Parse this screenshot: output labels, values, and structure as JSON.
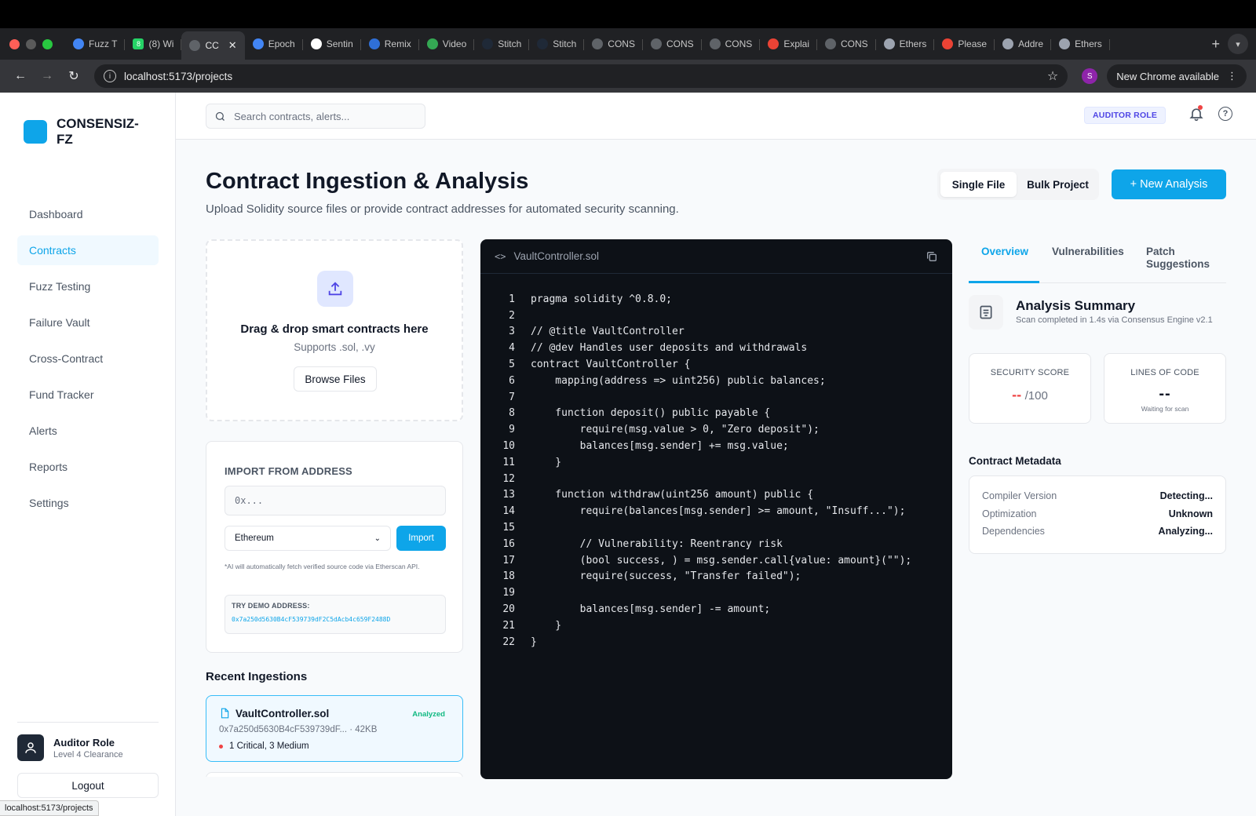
{
  "browser": {
    "tabs": [
      {
        "label": "Fuzz T",
        "icon": "gemini-icon",
        "color": "#4285f4"
      },
      {
        "label": "(8) Wi",
        "icon": "whatsapp-icon",
        "color": "#25d366",
        "badge": "8"
      },
      {
        "label": "CC",
        "icon": "globe-icon",
        "color": "#5f6368",
        "active": true
      },
      {
        "label": "Epoch",
        "icon": "docs-icon",
        "color": "#4285f4"
      },
      {
        "label": "Sentin",
        "icon": "openai-icon",
        "color": "#ffffff"
      },
      {
        "label": "Remix",
        "icon": "remix-icon",
        "color": "#2f6fd6"
      },
      {
        "label": "Video",
        "icon": "video-icon",
        "color": "#34a853"
      },
      {
        "label": "Stitch",
        "icon": "stitch-icon",
        "color": "#1f2937"
      },
      {
        "label": "Stitch",
        "icon": "stitch-icon",
        "color": "#1f2937"
      },
      {
        "label": "CONS",
        "icon": "globe-icon",
        "color": "#5f6368"
      },
      {
        "label": "CONS",
        "icon": "globe-icon",
        "color": "#5f6368"
      },
      {
        "label": "CONS",
        "icon": "globe-icon",
        "color": "#5f6368"
      },
      {
        "label": "Explai",
        "icon": "google-icon",
        "color": "#ea4335"
      },
      {
        "label": "CONS",
        "icon": "globe-icon",
        "color": "#5f6368"
      },
      {
        "label": "Ethers",
        "icon": "etherscan-icon",
        "color": "#9ca3af"
      },
      {
        "label": "Please",
        "icon": "gmail-icon",
        "color": "#ea4335"
      },
      {
        "label": "Addre",
        "icon": "etherscan-icon",
        "color": "#9ca3af"
      },
      {
        "label": "Ethers",
        "icon": "etherscan-icon",
        "color": "#9ca3af"
      }
    ],
    "url": "localhost:5173/projects",
    "profile_initial": "S",
    "new_chrome_label": "New Chrome available",
    "status_url": "localhost:5173/projects"
  },
  "sidebar": {
    "brand": "CONSENSIZ-FZ",
    "items": [
      {
        "label": "Dashboard",
        "active": false
      },
      {
        "label": "Contracts",
        "active": true
      },
      {
        "label": "Fuzz Testing",
        "active": false
      },
      {
        "label": "Failure Vault",
        "active": false
      },
      {
        "label": "Cross-Contract",
        "active": false
      },
      {
        "label": "Fund Tracker",
        "active": false
      },
      {
        "label": "Alerts",
        "active": false
      },
      {
        "label": "Reports",
        "active": false
      },
      {
        "label": "Settings",
        "active": false
      }
    ],
    "user_name": "Auditor Role",
    "user_level": "Level 4 Clearance",
    "logout_label": "Logout"
  },
  "topbar": {
    "search_placeholder": "Search contracts, alerts...",
    "role_badge": "AUDITOR ROLE"
  },
  "page": {
    "title": "Contract Ingestion & Analysis",
    "subtitle": "Upload Solidity source files or provide contract addresses for automated security scanning.",
    "mode_single": "Single File",
    "mode_bulk": "Bulk Project",
    "selected_mode": "Single File",
    "new_analysis": "+ New Analysis"
  },
  "upload": {
    "title": "Drag & drop smart contracts here",
    "subtitle": "Supports .sol, .vy",
    "browse_label": "Browse Files"
  },
  "import": {
    "title": "IMPORT FROM ADDRESS",
    "placeholder": "0x...",
    "network": "Ethereum",
    "button": "Import",
    "note": "*AI will automatically fetch verified source code via Etherscan API.",
    "demo_label": "TRY DEMO ADDRESS:",
    "demo_address": "0x7a250d5630B4cF539739dF2C5dAcb4c659F2488D"
  },
  "recent": {
    "title": "Recent Ingestions",
    "items": [
      {
        "name": "VaultController.sol",
        "status": "Analyzed",
        "meta": "0x7a250d5630B4cF539739dF... · 42KB",
        "severity": "1 Critical, 3 Medium"
      }
    ]
  },
  "code": {
    "filename": "VaultController.sol",
    "lines": [
      "pragma solidity ^0.8.0;",
      "",
      "// @title VaultController",
      "// @dev Handles user deposits and withdrawals",
      "contract VaultController {",
      "    mapping(address => uint256) public balances;",
      "",
      "    function deposit() public payable {",
      "        require(msg.value > 0, \"Zero deposit\");",
      "        balances[msg.sender] += msg.value;",
      "    }",
      "",
      "    function withdraw(uint256 amount) public {",
      "        require(balances[msg.sender] >= amount, \"Insuff...\");",
      "",
      "        // Vulnerability: Reentrancy risk",
      "        (bool success, ) = msg.sender.call{value: amount}(\"\");",
      "        require(success, \"Transfer failed\");",
      "",
      "        balances[msg.sender] -= amount;",
      "    }",
      "}"
    ]
  },
  "analysis": {
    "tabs": [
      "Overview",
      "Vulnerabilities",
      "Patch Suggestions"
    ],
    "active_tab": "Overview",
    "summary_title": "Analysis Summary",
    "summary_sub": "Scan completed in 1.4s via Consensus Engine v2.1",
    "security_score_label": "SECURITY SCORE",
    "security_score_value": "--",
    "security_score_max": "/100",
    "loc_label": "LINES OF CODE",
    "loc_value": "--",
    "loc_note": "Waiting for scan",
    "metadata_title": "Contract Metadata",
    "metadata": [
      {
        "key": "Compiler Version",
        "value": "Detecting..."
      },
      {
        "key": "Optimization",
        "value": "Unknown"
      },
      {
        "key": "Dependencies",
        "value": "Analyzing..."
      }
    ]
  },
  "colors": {
    "accent": "#0ea5e9",
    "critical": "#ef4444",
    "success": "#10b981",
    "badge": "#4f46e5"
  }
}
